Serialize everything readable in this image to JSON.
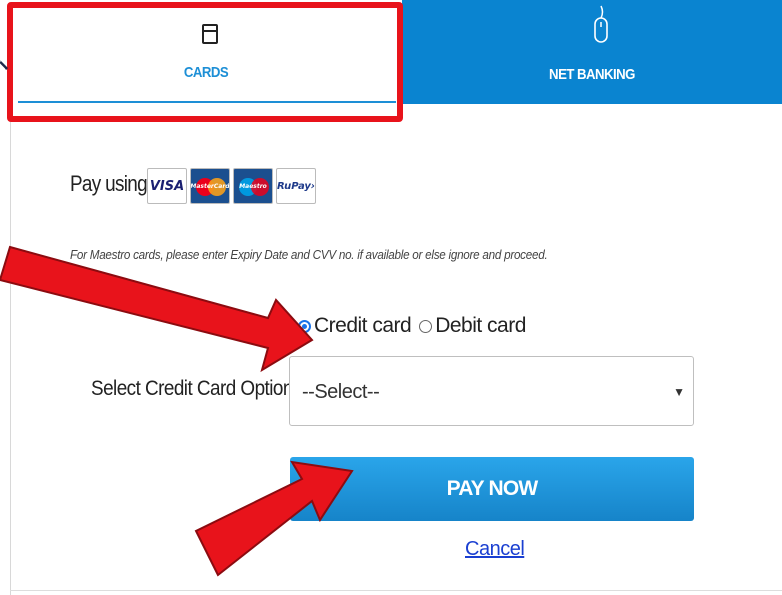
{
  "tabs": {
    "cards_label": "CARDS",
    "netbanking_label": "NET BANKING"
  },
  "payment": {
    "pay_using_label": "Pay using",
    "logos": [
      "VISA",
      "MasterCard",
      "Maestro",
      "RuPay"
    ],
    "maestro_note": "For Maestro cards, please enter Expiry Date and CVV no. if available or else ignore and proceed."
  },
  "card_type": {
    "options": [
      "Credit card",
      "Debit card"
    ],
    "selected": "Credit card"
  },
  "select": {
    "label": "Select Credit Card Option :",
    "value": "--Select--"
  },
  "actions": {
    "pay_now": "PAY NOW",
    "cancel": "Cancel"
  },
  "colors": {
    "accent": "#1d8fd6",
    "tab_active_bg": "#0a84d0",
    "annotation_red": "#e8131b",
    "link": "#1a3fd1"
  }
}
